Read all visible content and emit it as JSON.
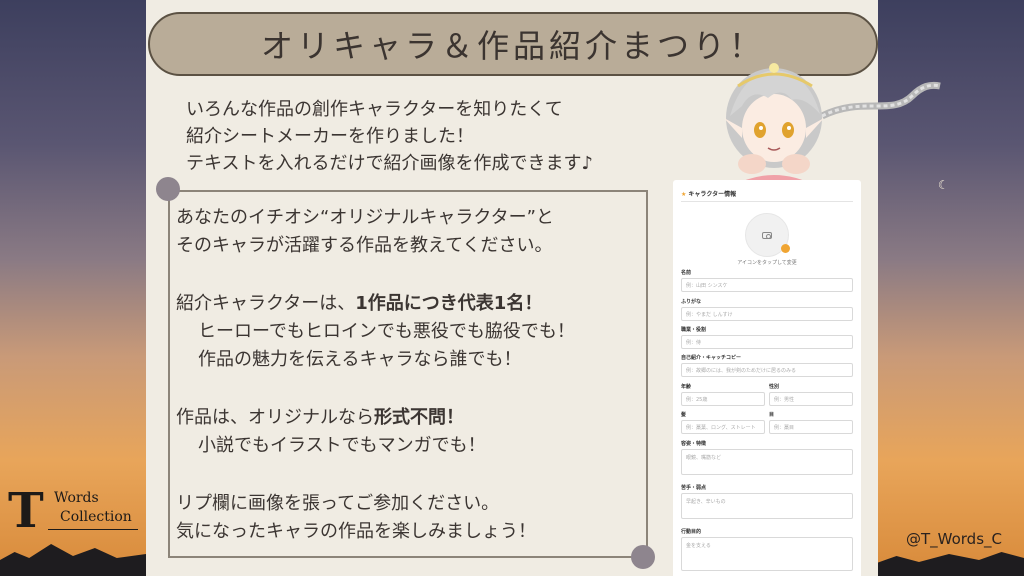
{
  "title": "オリキャラ＆作品紹介まつり！",
  "intro": [
    "いろんな作品の創作キャラクターを知りたくて",
    "紹介シートメーカーを作りました！",
    "テキストを入れるだけで紹介画像を作成できます♪"
  ],
  "body": {
    "p1_line1": "あなたのイチオシ“オリジナルキャラクター”と",
    "p1_line2": "そのキャラが活躍する作品を教えてください。",
    "p2_pre": "紹介キャラクターは、",
    "p2_bold": "1作品につき代表1名！",
    "p2_line2": "ヒーローでもヒロインでも悪役でも脇役でも！",
    "p2_line3": "作品の魅力を伝えるキャラなら誰でも！",
    "p3_pre": "作品は、オリジナルなら",
    "p3_bold": "形式不問！",
    "p3_line2": "小説でもイラストでもマンガでも！",
    "p4_line1": "リプ欄に画像を張ってご参加ください。",
    "p4_line2": "気になったキャラの作品を楽しみましょう！"
  },
  "form": {
    "header": "キャラクター情報",
    "avatar_caption": "アイコンをタップして変更",
    "name_label": "名前",
    "name_placeholder": "例：山田 シンスケ",
    "furigana_label": "ふりがな",
    "furigana_placeholder": "例：やまだ しんすけ",
    "job_label": "職業・役割",
    "job_placeholder": "例：侍",
    "intro_label": "自己紹介・キャッチコピー",
    "intro_placeholder": "例：故郷のには、我が剣のためだけに居るのみる",
    "age_label": "年齢",
    "age_placeholder": "例：25歳",
    "gender_label": "性別",
    "gender_placeholder": "例：男性",
    "hair_label": "髪",
    "hair_placeholder": "例：藁葉、ロング、ストレート",
    "eye_label": "目",
    "eye_placeholder": "例：藁目",
    "feature_label": "容姿・特徴",
    "feature_placeholder": "眼鏡、嘴筋など",
    "weak_label": "苦手・弱点",
    "weak_placeholder": "早起き、辛いもの",
    "motto_label": "行動目的",
    "motto_placeholder": "金を支える"
  },
  "logo": {
    "letter": "T",
    "line1": "Words",
    "line2": "Collection"
  },
  "handle": "@T_Words_C",
  "moon": "☾"
}
